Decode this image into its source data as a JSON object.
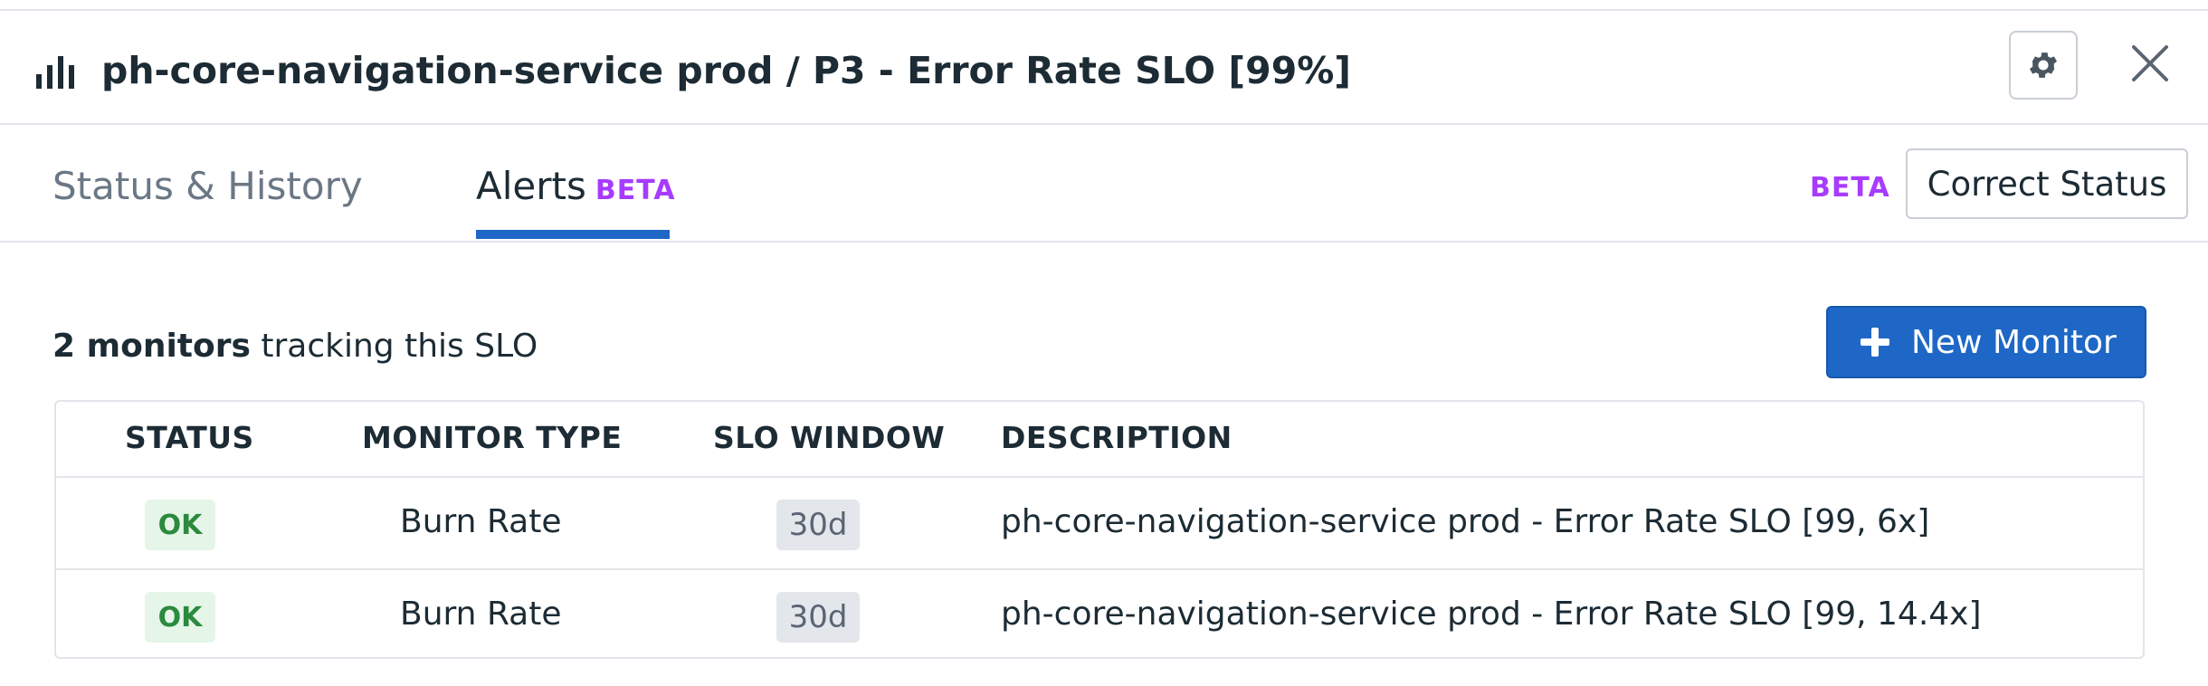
{
  "header": {
    "title": "ph-core-navigation-service prod / P3 - Error Rate SLO [99%]",
    "icon": "bar-chart-icon",
    "settings_icon": "gear-icon",
    "close_icon": "close-icon"
  },
  "tabs": [
    {
      "label": "Status & History",
      "active": false
    },
    {
      "label": "Alerts",
      "badge": "BETA",
      "active": true
    }
  ],
  "toolbar": {
    "beta_label": "BETA",
    "correct_status_label": "Correct Status"
  },
  "monitors": {
    "count_label": "2 monitors",
    "summary_suffix": " tracking this SLO",
    "new_monitor_label": "New Monitor",
    "new_monitor_icon": "plus-icon"
  },
  "table": {
    "columns": [
      "STATUS",
      "MONITOR TYPE",
      "SLO WINDOW",
      "DESCRIPTION"
    ],
    "rows": [
      {
        "status": "OK",
        "monitor_type": "Burn Rate",
        "slo_window": "30d",
        "description": "ph-core-navigation-service prod - Error Rate SLO [99, 6x]"
      },
      {
        "status": "OK",
        "monitor_type": "Burn Rate",
        "slo_window": "30d",
        "description": "ph-core-navigation-service prod - Error Rate SLO [99, 14.4x]"
      }
    ]
  },
  "colors": {
    "accent": "#1e67c6",
    "beta": "#a73bff",
    "ok_text": "#2b8a3e",
    "ok_bg": "#e5f5e8"
  }
}
